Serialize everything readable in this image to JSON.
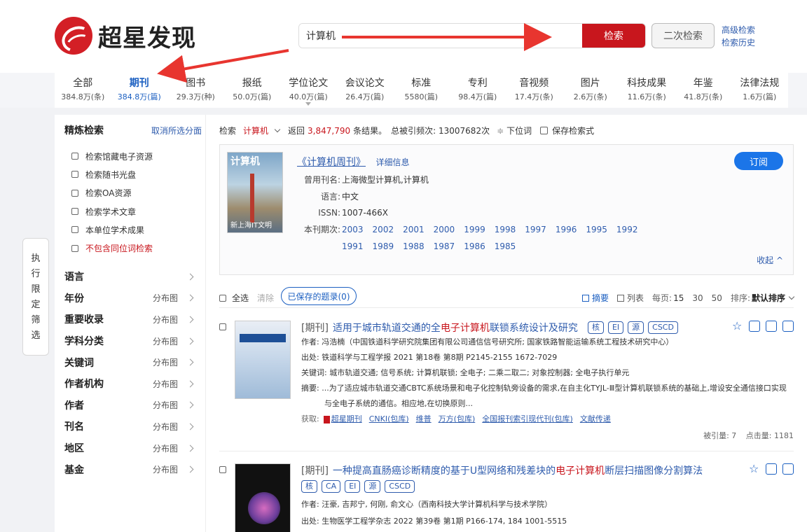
{
  "brand": {
    "name": "超星发现"
  },
  "search": {
    "value": "计算机",
    "button": "检索",
    "second_button": "二次检索",
    "advanced": "高级检索",
    "history": "检索历史"
  },
  "categories": [
    {
      "label": "全部",
      "count": "384.8万(条)"
    },
    {
      "label": "期刊",
      "count": "384.8万(篇)"
    },
    {
      "label": "图书",
      "count": "29.3万(种)"
    },
    {
      "label": "报纸",
      "count": "50.0万(篇)"
    },
    {
      "label": "学位论文",
      "count": "40.0万(篇)"
    },
    {
      "label": "会议论文",
      "count": "26.4万(篇)"
    },
    {
      "label": "标准",
      "count": "5580(篇)"
    },
    {
      "label": "专利",
      "count": "98.4万(篇)"
    },
    {
      "label": "音视频",
      "count": "17.4万(条)"
    },
    {
      "label": "图片",
      "count": "2.6万(条)"
    },
    {
      "label": "科技成果",
      "count": "11.6万(条)"
    },
    {
      "label": "年鉴",
      "count": "41.8万(条)"
    },
    {
      "label": "法律法规",
      "count": "1.6万(篇)"
    }
  ],
  "side_panel": [
    "执",
    "行",
    "限",
    "定",
    "筛",
    "选"
  ],
  "filter": {
    "title": "精炼检索",
    "cancel": "取消所选分面",
    "checks": [
      "检索馆藏电子资源",
      "检索随书光盘",
      "检索OA资源",
      "检索学术文章",
      "本单位学术成果",
      "不包含同位词检索"
    ],
    "facets": [
      {
        "label": "语言",
        "dist": ""
      },
      {
        "label": "年份",
        "dist": "分布图"
      },
      {
        "label": "重要收录",
        "dist": "分布图"
      },
      {
        "label": "学科分类",
        "dist": "分布图"
      },
      {
        "label": "关键词",
        "dist": "分布图"
      },
      {
        "label": "作者机构",
        "dist": "分布图"
      },
      {
        "label": "作者",
        "dist": "分布图"
      },
      {
        "label": "刊名",
        "dist": "分布图"
      },
      {
        "label": "地区",
        "dist": "分布图"
      },
      {
        "label": "基金",
        "dist": "分布图"
      }
    ]
  },
  "meta": {
    "search_label": "检索",
    "term": "计算机",
    "return_prefix": "返回",
    "count": "3,847,790",
    "return_suffix": "条结果。",
    "cited": "总被引频次: 13007682次",
    "drill": "下位词",
    "save": "保存检索式"
  },
  "journal": {
    "cover_title": "计算机",
    "cover_footer": "新上海IT文明",
    "title": "《计算机周刊》",
    "detail": "详细信息",
    "subscribe": "订阅",
    "collapse": "收起",
    "rows": [
      {
        "k": "曾用刊名:",
        "v": "上海微型计算机,计算机"
      },
      {
        "k": "语言:",
        "v": "中文"
      },
      {
        "k": "ISSN:",
        "v": "1007-466X"
      }
    ],
    "issues_label": "本刊期次:",
    "years": [
      "2003",
      "2002",
      "2001",
      "2000",
      "1999",
      "1998",
      "1997",
      "1996",
      "1995",
      "1992",
      "1991",
      "1989",
      "1988",
      "1987",
      "1986",
      "1985"
    ]
  },
  "toolbar": {
    "select_all": "全选",
    "clear": "清除",
    "saved": "已保存的题录(0)",
    "abstract": "摘要",
    "list": "列表",
    "per_page": "每页:",
    "pages": [
      "15",
      "30",
      "50"
    ],
    "sort_label": "排序:",
    "sort_value": "默认排序"
  },
  "results": [
    {
      "type": "[期刊]",
      "title_a": "适用于城市轨道交通的全",
      "title_hl1": "电子计算机",
      "title_b": "联锁系统设计及研究",
      "tags": [
        "核",
        "EI",
        "源",
        "CSCD"
      ],
      "author": "作者: 冯浩楠（中国铁道科学研究院集团有限公司通信信号研究所; 国家铁路智能运输系统工程技术研究中心）",
      "source": "出处: 铁道科学与工程学报 2021 第18卷 第8期 P2145-2155 1672-7029",
      "keywords": "关键词: 城市轨道交通; 信号系统; 计算机联锁; 全电子; 二乘二取二; 对象控制器; 全电子执行单元",
      "abstract1": "摘要: ...为了适应城市轨道交通CBTC系统场景和电子化控制轨旁设备的需求,在自主化TYJL-Ⅲ型计算机联锁系统的基础上,增设安全通信接口实现",
      "abstract2": "与全电子系统的通信。相应地,在切换原则...",
      "get_label": "获取:",
      "links": [
        "超星期刊",
        "CNKI(包库)",
        "维普",
        "万方(包库)",
        "全国报刊索引现代刊(包库)",
        "文献传递"
      ],
      "cited": "被引量: 7",
      "clicks": "点击量: 1181"
    },
    {
      "type": "[期刊]",
      "title_a": "一种提高直肠癌诊断精度的基于U型网络和残差块的",
      "title_hl1": "电子计算机",
      "title_b": "断层扫描图像分割算法",
      "tags": [
        "核",
        "CA",
        "EI",
        "源",
        "CSCD"
      ],
      "author": "作者: 汪豪, 吉邦宁, 何刚, 俞文心（西南科技大学计算机科学与技术学院）",
      "source": "出处: 生物医学工程学杂志 2022 第39卷 第1期 P166-174, 184 1001-5515"
    }
  ],
  "colors": {
    "brand_red": "#c8161d",
    "link_blue": "#2f5cad",
    "active_blue": "#1b5fc1",
    "annotation_red": "#e8352f"
  }
}
